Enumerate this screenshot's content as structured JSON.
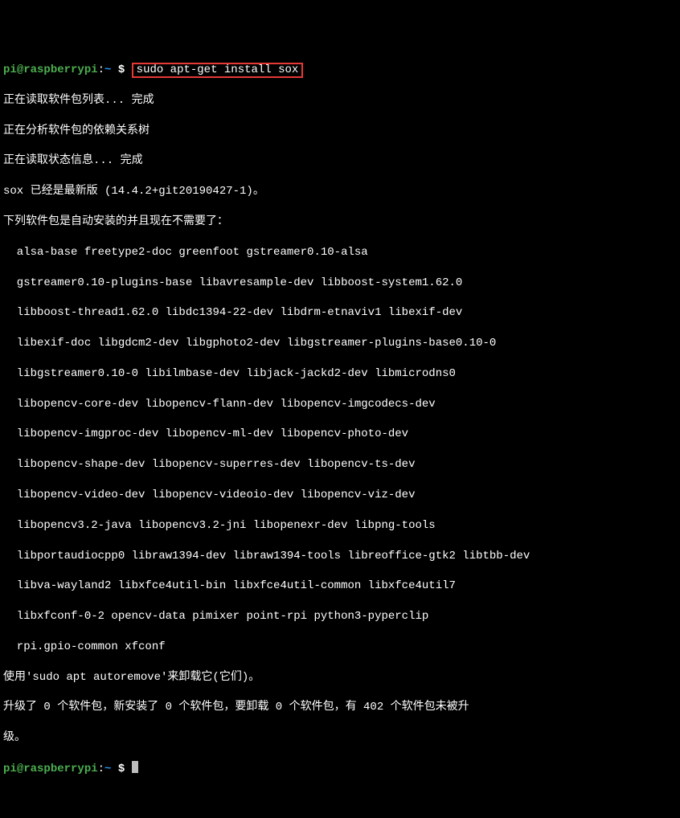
{
  "prompt1": {
    "user": "pi",
    "at": "@",
    "host": "raspberrypi",
    "colon": ":",
    "path": "~",
    "dollar": " $ ",
    "command": "sudo apt-get install sox"
  },
  "lines": {
    "l1": "正在读取软件包列表... 完成",
    "l2": "正在分析软件包的依赖关系树",
    "l3": "正在读取状态信息... 完成",
    "l4": "sox 已经是最新版 (14.4.2+git20190427-1)。",
    "l5": "下列软件包是自动安装的并且现在不需要了：",
    "l6": "  alsa-base freetype2-doc greenfoot gstreamer0.10-alsa",
    "l7": "  gstreamer0.10-plugins-base libavresample-dev libboost-system1.62.0",
    "l8": "  libboost-thread1.62.0 libdc1394-22-dev libdrm-etnaviv1 libexif-dev",
    "l9": "  libexif-doc libgdcm2-dev libgphoto2-dev libgstreamer-plugins-base0.10-0",
    "l10": "  libgstreamer0.10-0 libilmbase-dev libjack-jackd2-dev libmicrodns0",
    "l11": "  libopencv-core-dev libopencv-flann-dev libopencv-imgcodecs-dev",
    "l12": "  libopencv-imgproc-dev libopencv-ml-dev libopencv-photo-dev",
    "l13": "  libopencv-shape-dev libopencv-superres-dev libopencv-ts-dev",
    "l14": "  libopencv-video-dev libopencv-videoio-dev libopencv-viz-dev",
    "l15": "  libopencv3.2-java libopencv3.2-jni libopenexr-dev libpng-tools",
    "l16": "  libportaudiocpp0 libraw1394-dev libraw1394-tools libreoffice-gtk2 libtbb-dev",
    "l17": "  libva-wayland2 libxfce4util-bin libxfce4util-common libxfce4util7",
    "l18": "  libxfconf-0-2 opencv-data pimixer point-rpi python3-pyperclip",
    "l19": "  rpi.gpio-common xfconf",
    "l20": "使用'sudo apt autoremove'来卸载它(它们)。",
    "l21": "升级了 0 个软件包，新安装了 0 个软件包，要卸载 0 个软件包，有 402 个软件包未被升",
    "l22": "级。"
  },
  "prompt2": {
    "user": "pi",
    "at": "@",
    "host": "raspberrypi",
    "colon": ":",
    "path": "~",
    "dollar": " $ "
  }
}
